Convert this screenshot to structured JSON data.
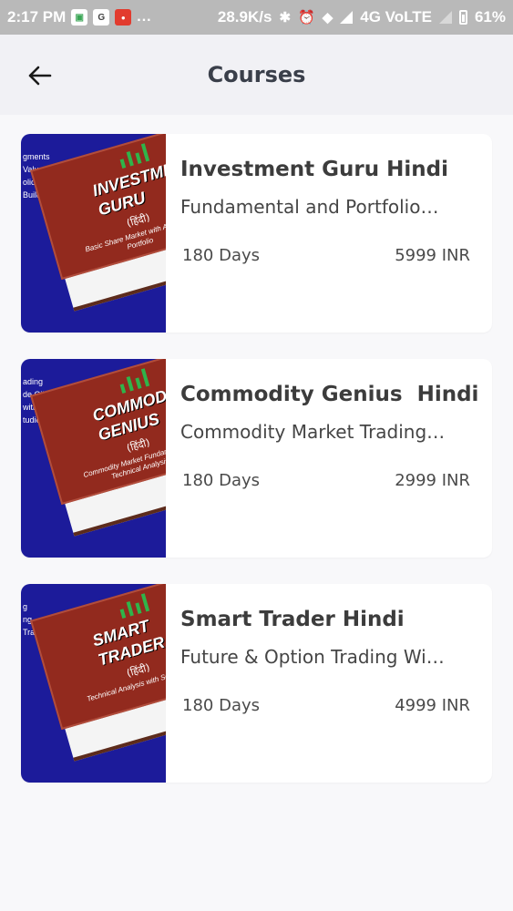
{
  "status_bar": {
    "time": "2:17 PM",
    "dots": "...",
    "speed": "28.9K/s",
    "network": "4G VoLTE",
    "battery": "61%"
  },
  "header": {
    "title": "Courses"
  },
  "courses": [
    {
      "title": "Investment Guru Hindi",
      "subtitle": "Fundamental and Portfolio…",
      "duration": "180 Days",
      "price": "5999 INR",
      "thumb_lines": [
        "gments",
        "Valuation",
        "olio with CAGR",
        "Builder Plan"
      ],
      "book_title": "INVESTMENT GURU",
      "book_hindi": "(हिंदी)",
      "book_sub": "Basic Share Market with Advance Portfolio"
    },
    {
      "title": "Commodity Genius  Hindi",
      "subtitle": "Commodity Market Trading…",
      "duration": "180 Days",
      "price": "2999 INR",
      "thumb_lines": [
        "ading",
        "de Oil, NG...",
        "with Software",
        "tudies"
      ],
      "book_title": "COMMODITY GENIUS",
      "book_hindi": "(हिंदी)",
      "book_sub": "Commodity Market Fundamental & Technical Analysis"
    },
    {
      "title": "Smart Trader Hindi",
      "subtitle": "Future & Option Trading Wi…",
      "duration": "180 Days",
      "price": "4999 INR",
      "thumb_lines": [
        "g",
        "",
        "ng",
        "Trading"
      ],
      "book_title": "SMART TRADER",
      "book_hindi": "(हिंदी)",
      "book_sub": "Technical Analysis with Software"
    }
  ],
  "colors": {
    "thumb_bg": "#1c1b9a",
    "book_cover": "#922a1e",
    "candle": "#2fb44a"
  }
}
